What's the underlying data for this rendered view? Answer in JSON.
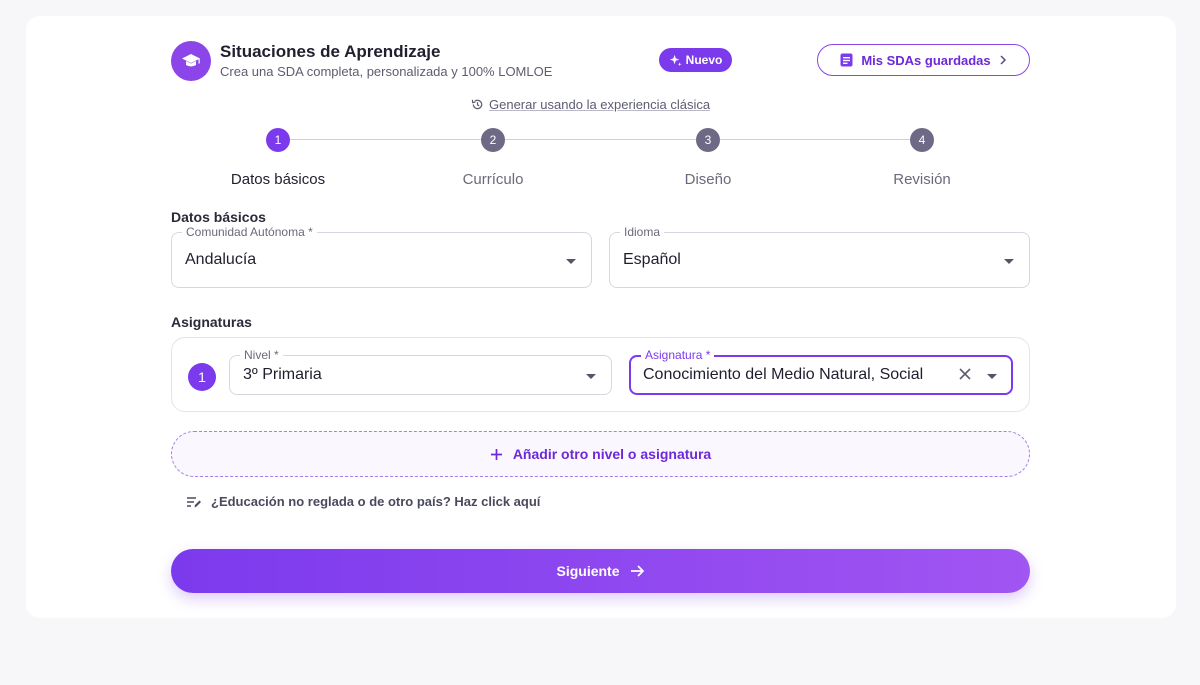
{
  "header": {
    "title": "Situaciones de Aprendizaje",
    "subtitle": "Crea una SDA completa, personalizada y 100% LOMLOE",
    "new_badge": "Nuevo",
    "saved_button": "Mis SDAs guardadas",
    "classic_link": "Generar usando la experiencia clásica"
  },
  "stepper": {
    "current_step": 1,
    "steps": [
      {
        "number": "1",
        "label": "Datos básicos"
      },
      {
        "number": "2",
        "label": "Currículo"
      },
      {
        "number": "3",
        "label": "Diseño"
      },
      {
        "number": "4",
        "label": "Revisión"
      }
    ]
  },
  "basic_data": {
    "section_title": "Datos básicos",
    "community": {
      "label": "Comunidad Autónoma *",
      "value": "Andalucía"
    },
    "language": {
      "label": "Idioma",
      "value": "Español"
    }
  },
  "subjects": {
    "section_title": "Asignaturas",
    "rows": [
      {
        "index": "1",
        "level": {
          "label": "Nivel *",
          "value": "3º Primaria"
        },
        "subject": {
          "label": "Asignatura *",
          "value": "Conocimiento del Medio Natural, Social"
        }
      }
    ],
    "add_button": "Añadir otro nivel o asignatura",
    "other_link": "¿Educación no reglada o de otro país? Haz click aquí"
  },
  "footer": {
    "next_button": "Siguiente"
  },
  "colors": {
    "accent": "#7c3aed",
    "accent_light": "#a155f2",
    "step_idle": "#6e6a85",
    "background": "#f7f7fa"
  }
}
